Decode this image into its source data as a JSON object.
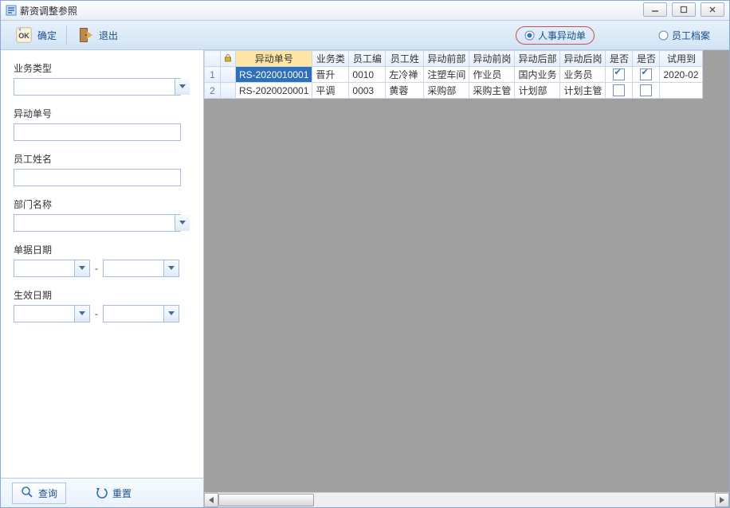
{
  "window": {
    "title": "薪资调整参照"
  },
  "toolbar": {
    "ok_label": "确定",
    "exit_label": "退出",
    "radio_hr_change": "人事异动单",
    "radio_emp_file": "员工档案"
  },
  "filters": {
    "biz_type_label": "业务类型",
    "change_no_label": "异动单号",
    "emp_name_label": "员工姓名",
    "dept_name_label": "部门名称",
    "doc_date_label": "单据日期",
    "eff_date_label": "生效日期",
    "sep": "-"
  },
  "footer": {
    "query_label": "查询",
    "reset_label": "重置"
  },
  "grid": {
    "headers": {
      "c1": "异动单号",
      "c2": "业务类",
      "c3": "员工编",
      "c4": "员工姓",
      "c5": "异动前部",
      "c6": "异动前岗",
      "c7": "异动后部",
      "c8": "异动后岗",
      "c9": "是否",
      "c10": "是否",
      "c11": "试用到"
    },
    "rows": [
      {
        "n": "1",
        "c1": "RS-2020010001",
        "c2": "晋升",
        "c3": "0010",
        "c4": "左冷禅",
        "c5": "注塑车间",
        "c6": "作业员",
        "c7": "国内业务",
        "c8": "业务员",
        "c9": true,
        "c10": true,
        "c11": "2020-02",
        "sel": true
      },
      {
        "n": "2",
        "c1": "RS-2020020001",
        "c2": "平调",
        "c3": "0003",
        "c4": "黄蓉",
        "c5": "采购部",
        "c6": "采购主管",
        "c7": "计划部",
        "c8": "计划主管",
        "c9": false,
        "c10": false,
        "c11": "",
        "sel": false
      }
    ]
  }
}
